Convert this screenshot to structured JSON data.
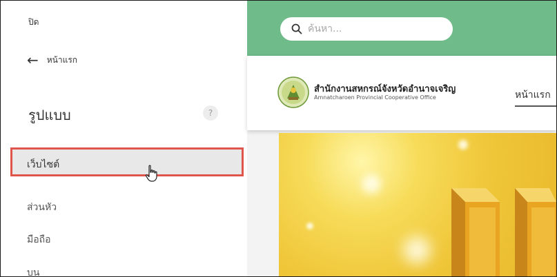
{
  "editor": {
    "close_label": "ปิด",
    "back_label": "หน้าแรก",
    "section_title": "รูปแบบ",
    "help_label": "?",
    "nav_items": [
      {
        "label": "เว็บไซต์"
      },
      {
        "label": "ส่วนหัว"
      },
      {
        "label": "มือถือ"
      },
      {
        "label": "บน"
      }
    ],
    "highlight_color": "#e0554b"
  },
  "preview": {
    "search_placeholder": "ค้นหา...",
    "org_name": "สำนักงานสหกรณ์จังหวัดอำนาจเจริญ",
    "org_subtitle": "Amnatcharoen Provincial Cooperative Office",
    "nav_home": "หน้าแรก",
    "topbar_color": "#6fbb8a"
  }
}
